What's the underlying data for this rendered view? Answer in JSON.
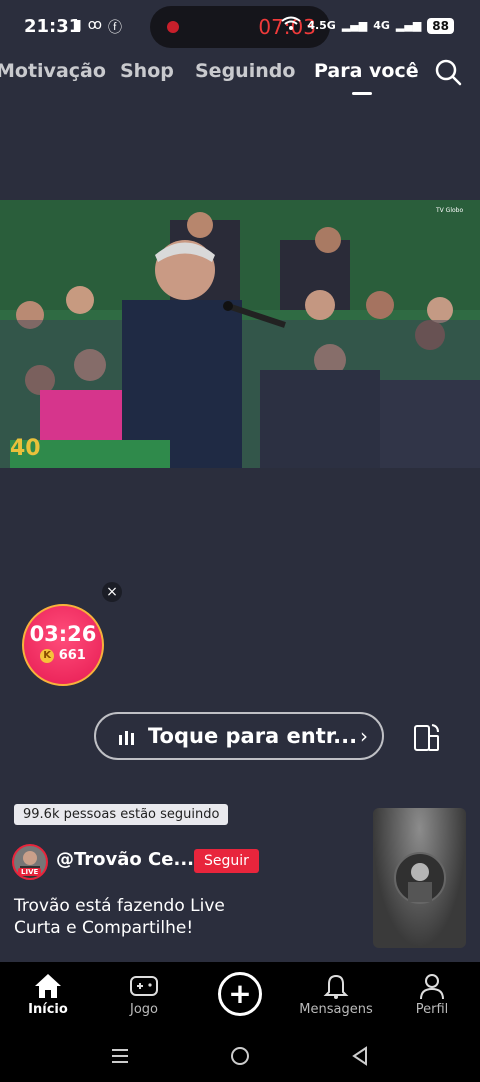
{
  "status": {
    "time": "21:31",
    "recording_timer": "07:03",
    "network_1": "4.5G",
    "network_2": "4G",
    "battery": "88"
  },
  "top_nav": {
    "tabs": [
      {
        "label": "Motivação"
      },
      {
        "label": "Shop"
      },
      {
        "label": "Seguindo"
      },
      {
        "label": "Para você"
      }
    ],
    "active_tab": "Para você"
  },
  "video": {
    "watermark": "TV Globo",
    "logo_text": "40"
  },
  "floating_timer": {
    "time": "03:26",
    "coin_symbol": "K",
    "coins": "661",
    "close_symbol": "×"
  },
  "enter_button": {
    "label": "Toque para entr...",
    "chevron": "›"
  },
  "live": {
    "followers_text": "99.6k pessoas estão seguindo",
    "live_tag": "LIVE",
    "username": "@Trovão Ce...",
    "follow_label": "Seguir",
    "caption_line1": "Trovão está fazendo Live",
    "caption_line2": "Curta e Compartilhe!"
  },
  "bottom_nav": {
    "items": [
      {
        "label": "Início",
        "icon": "home-icon"
      },
      {
        "label": "Jogo",
        "icon": "gamepad-icon"
      },
      {
        "label": "",
        "icon": "add-icon"
      },
      {
        "label": "Mensagens",
        "icon": "bell-icon"
      },
      {
        "label": "Perfil",
        "icon": "profile-icon"
      }
    ]
  },
  "colors": {
    "background": "#2b2e3d",
    "accent_red": "#e8253c",
    "timer_pink": "#e61a52",
    "coin_gold": "#f6c33a"
  }
}
